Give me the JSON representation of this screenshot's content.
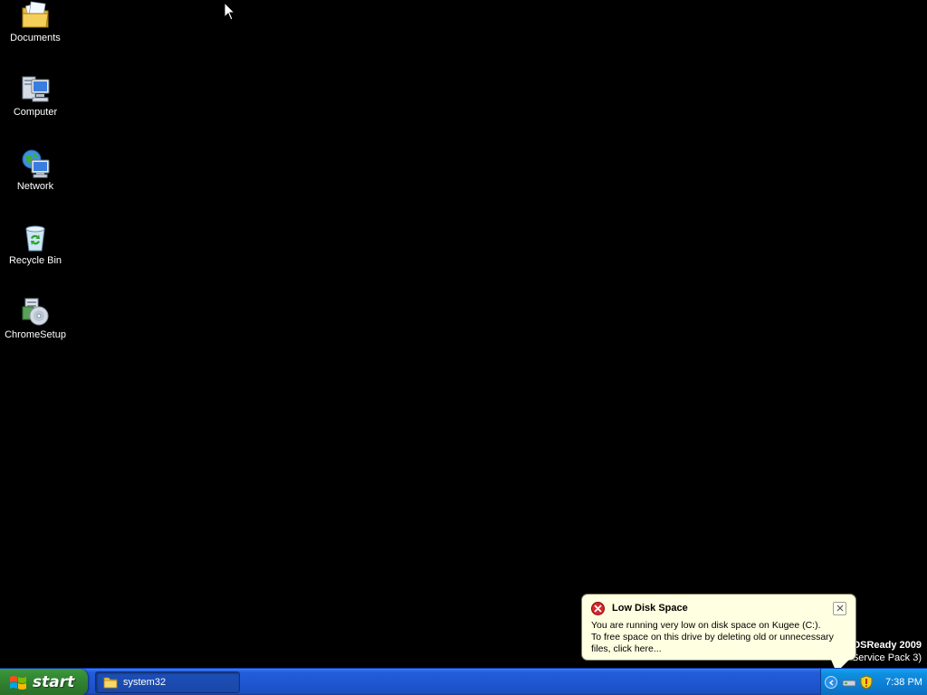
{
  "desktop": {
    "icons": [
      {
        "label": "Documents",
        "icon": "documents-folder-icon"
      },
      {
        "label": "Computer",
        "icon": "computer-icon"
      },
      {
        "label": "Network",
        "icon": "network-icon"
      },
      {
        "label": "Recycle Bin",
        "icon": "recycle-bin-icon"
      },
      {
        "label": "ChromeSetup",
        "icon": "installer-icon"
      }
    ]
  },
  "watermark": {
    "title": "OSReady 2009",
    "subtitle": "Service Pack 3)"
  },
  "balloon": {
    "title": "Low Disk Space",
    "line1": "You are running very low on disk space on Kugee (C:).",
    "line2": "To free space on this drive by deleting old or unnecessary files, click here..."
  },
  "taskbar": {
    "start_label": "start",
    "tasks": [
      {
        "label": "system32",
        "icon": "folder-icon"
      }
    ],
    "tray": {
      "clock": "7:38 PM"
    }
  },
  "colors": {
    "taskbar_blue": "#245edb",
    "start_green": "#378f37",
    "balloon_bg": "#ffffe1",
    "error_red": "#d8262a"
  }
}
